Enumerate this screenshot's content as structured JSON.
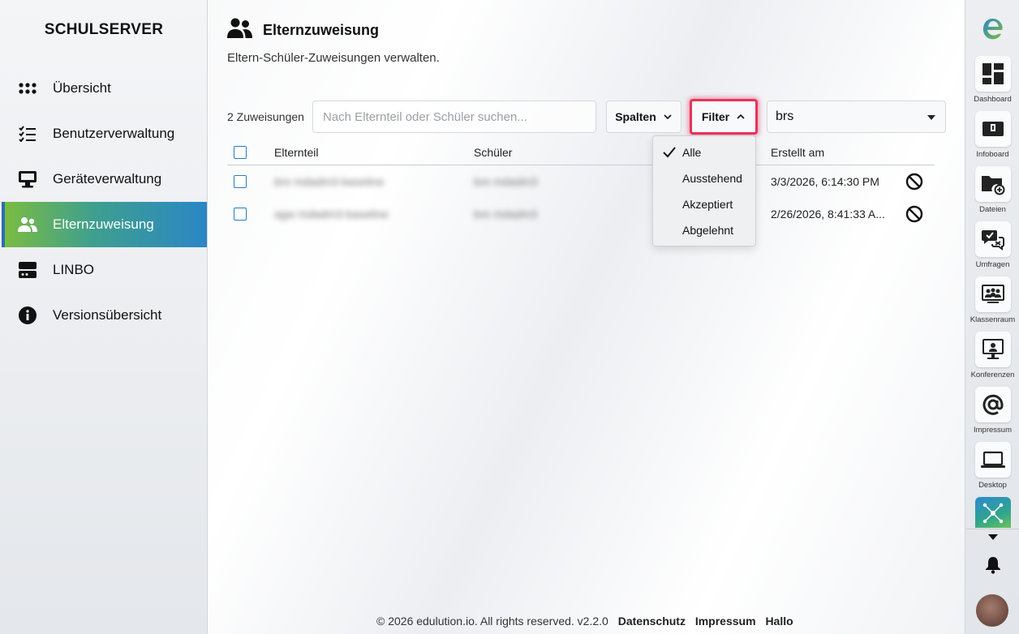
{
  "sidebar": {
    "brand": "SCHULSERVER",
    "items": [
      {
        "label": "Übersicht",
        "icon": "grid-icon"
      },
      {
        "label": "Benutzerverwaltung",
        "icon": "checklist-icon"
      },
      {
        "label": "Geräteverwaltung",
        "icon": "monitor-icon"
      },
      {
        "label": "Elternzuweisung",
        "icon": "users-icon",
        "active": true
      },
      {
        "label": "LINBO",
        "icon": "server-icon"
      },
      {
        "label": "Versionsübersicht",
        "icon": "info-icon"
      }
    ]
  },
  "page": {
    "title": "Elternzuweisung",
    "description": "Eltern-Schüler-Zuweisungen verwalten."
  },
  "toolbar": {
    "count": "2 Zuweisungen",
    "search_placeholder": "Nach Elternteil oder Schüler suchen...",
    "columns_label": "Spalten",
    "filter_label": "Filter",
    "school_select": "brs"
  },
  "table": {
    "headers": {
      "parent": "Elternteil",
      "student": "Schüler",
      "created": "Erstellt am"
    },
    "rows": [
      {
        "parent": "bre mdadm3-baseline",
        "student": "bre mdadm3",
        "created": "3/3/2026, 6:14:30 PM"
      },
      {
        "parent": "agw mdadm3-baseline",
        "student": "bre mdadm3",
        "created": "2/26/2026, 8:41:33 A..."
      }
    ]
  },
  "filter_menu": {
    "options": [
      "Alle",
      "Ausstehend",
      "Akzeptiert",
      "Abgelehnt"
    ],
    "selected": "Alle"
  },
  "dock": {
    "items": [
      {
        "label": "Dashboard",
        "icon": "dashboard-icon"
      },
      {
        "label": "Infoboard",
        "icon": "infoboard-icon"
      },
      {
        "label": "Dateien",
        "icon": "folder-icon"
      },
      {
        "label": "Umfragen",
        "icon": "survey-icon"
      },
      {
        "label": "Klassenraum",
        "icon": "classroom-icon"
      },
      {
        "label": "Konferenzen",
        "icon": "conference-icon"
      },
      {
        "label": "Impressum",
        "icon": "at-icon"
      },
      {
        "label": "Desktop",
        "icon": "laptop-icon"
      }
    ]
  },
  "footer": {
    "copyright": "© 2026 edulution.io. All rights reserved. v2.2.0",
    "links": [
      "Datenschutz",
      "Impressum",
      "Hallo"
    ]
  },
  "colors": {
    "accent_green": "#7cbd3f",
    "accent_blue": "#2b86c5",
    "filter_highlight": "#e8345a"
  }
}
